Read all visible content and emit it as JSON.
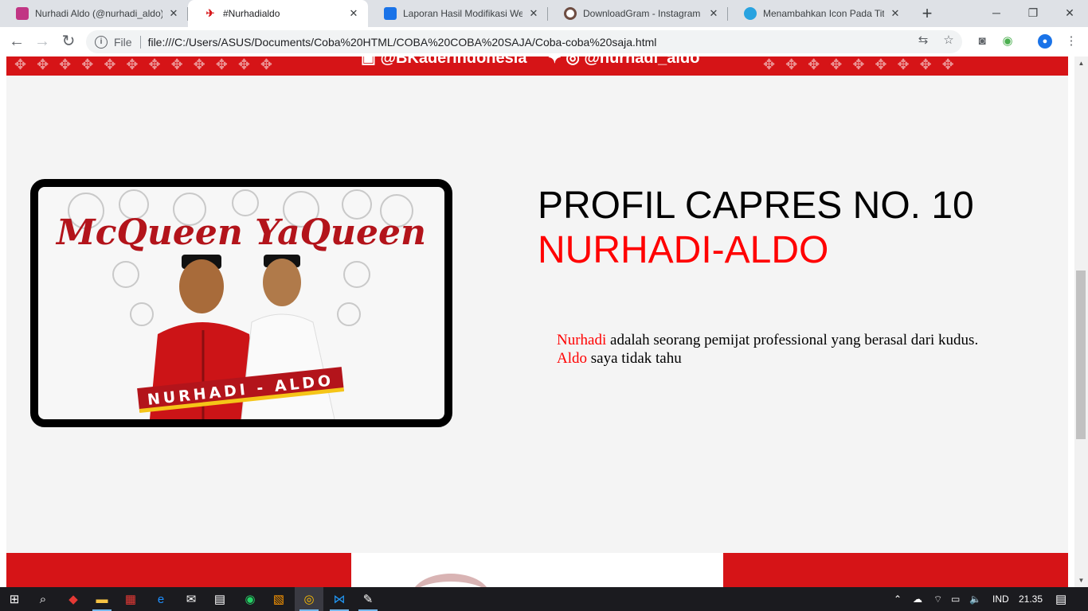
{
  "tabs": [
    {
      "title": "Nurhadi Aldo (@nurhadi_aldo)",
      "favicon": "instagram-icon",
      "color": "#c13584"
    },
    {
      "title": "#Nurhadialdo",
      "favicon": "nurhadi-aldo-logo-icon",
      "color": "#d61417"
    },
    {
      "title": "Laporan Hasil Modifikasi Web",
      "favicon": "google-classroom-icon",
      "color": "#1a73e8"
    },
    {
      "title": "DownloadGram - Instagram ph",
      "favicon": "downloadgram-icon",
      "color": "#6d4c41"
    },
    {
      "title": "Menambahkan Icon Pada Title",
      "favicon": "website-icon",
      "color": "#29a3e0"
    }
  ],
  "toolbar": {
    "scheme_label": "File",
    "url": "file:///C:/Users/ASUS/Documents/Coba%20HTML/COBA%20COBA%20SAJA/Coba-coba%20saja.html"
  },
  "page": {
    "banner_social_left": "@BKaderindonesia",
    "banner_social_right": "@nurhadi_aldo",
    "heading_line1": "PROFIL CAPRES NO. 10",
    "heading_line2": "NURHADI-ALDO",
    "paragraph": {
      "name1": "Nurhadi",
      "text1": "adalah seorang pemijat professional yang berasal dari kudus.",
      "name2": "Aldo",
      "text2": "saya tidak tahu"
    },
    "photo": {
      "headline": "McQueen YaQueen",
      "caption": "NURHADI - ALDO"
    }
  },
  "taskbar": {
    "language": "IND",
    "time": "21.35"
  },
  "colors": {
    "brand_red": "#d61417",
    "text_red": "#ff0000",
    "page_bg": "#f4f4f4"
  }
}
